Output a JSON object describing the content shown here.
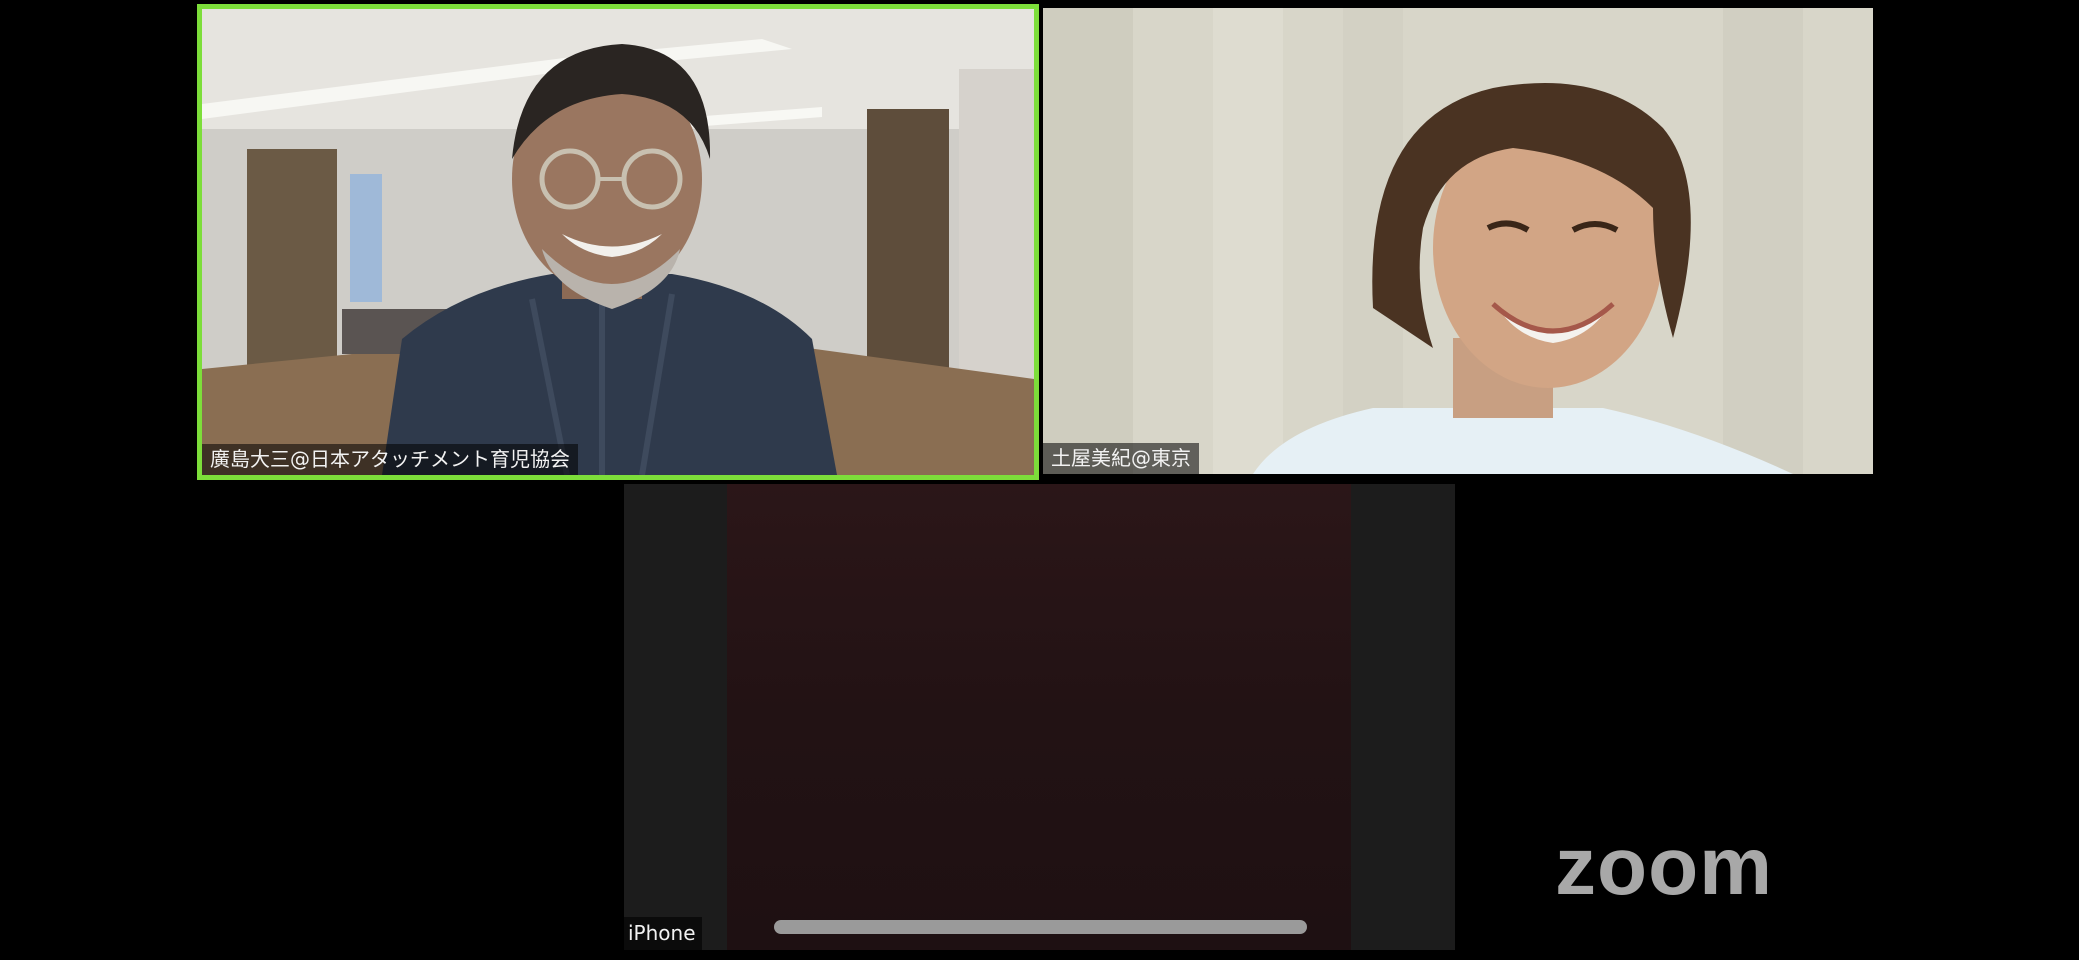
{
  "app": {
    "name": "Zoom",
    "logo_text": "zoom"
  },
  "participants": [
    {
      "name": "廣島大三@日本アタッチメント育児協会",
      "active_speaker": true,
      "video": "on",
      "highlight_color": "#7dde3a"
    },
    {
      "name": "土屋美紀@東京",
      "active_speaker": false,
      "video": "on"
    },
    {
      "name": "iPhone",
      "active_speaker": false,
      "video": "dark"
    }
  ],
  "colors": {
    "background": "#000000",
    "active_speaker_border": "#7dde3a",
    "logo": "#a8a8a8"
  }
}
